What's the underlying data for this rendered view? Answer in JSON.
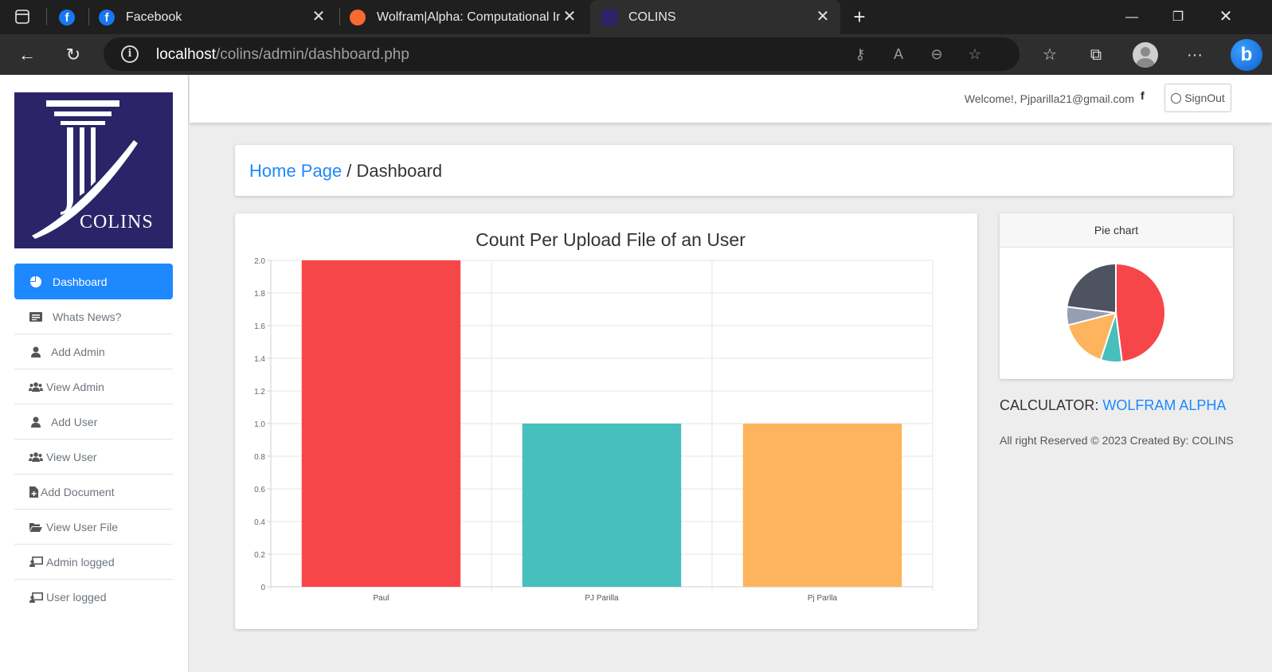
{
  "browser": {
    "tabs": [
      {
        "title": "Facebook",
        "icon": "facebook-icon"
      },
      {
        "title": "Wolfram|Alpha: Computational Intelligence",
        "icon": "wolfram-icon"
      },
      {
        "title": "COLINS",
        "icon": "colins-icon",
        "active": true
      }
    ],
    "url_host": "localhost",
    "url_path": "/colins/admin/dashboard.php"
  },
  "sidebar": {
    "logo_text": "COLINS",
    "items": [
      {
        "label": "Dashboard",
        "icon": "chart-pie-icon",
        "active": true
      },
      {
        "label": "Whats News?",
        "icon": "newspaper-icon"
      },
      {
        "label": "Add Admin",
        "icon": "user-icon"
      },
      {
        "label": "View Admin",
        "icon": "users-icon"
      },
      {
        "label": "Add User",
        "icon": "user-icon"
      },
      {
        "label": "View User",
        "icon": "users-icon"
      },
      {
        "label": "Add Document",
        "icon": "file-plus-icon"
      },
      {
        "label": "View User File",
        "icon": "folder-open-icon"
      },
      {
        "label": "Admin logged",
        "icon": "chalkboard-user-icon"
      },
      {
        "label": "User logged",
        "icon": "chalkboard-user-icon"
      }
    ]
  },
  "header": {
    "welcome": "Welcome!, Pjparilla21@gmail.com",
    "signout_label": "SignOut"
  },
  "breadcrumb": {
    "home": "Home Page",
    "separator": " / ",
    "current": "Dashboard"
  },
  "pie": {
    "title": "Pie chart"
  },
  "calculator": {
    "label": "CALCULATOR:",
    "link": "WOLFRAM ALPHA"
  },
  "footer": {
    "text": "All right Reserved © 2023 Created By: COLINS"
  },
  "colors": {
    "primary": "#1e88ff",
    "red": "#f7464a",
    "teal": "#46bfbd",
    "orange": "#fdb45c",
    "gray": "#949fb1",
    "dark": "#4d5360",
    "logo_bg": "#2b2468"
  },
  "chart_data": [
    {
      "type": "bar",
      "title": "Count Per Upload File of an User",
      "categories": [
        "Paul",
        "PJ Parilla",
        "Pj Parlla"
      ],
      "values": [
        2,
        1,
        1
      ],
      "colors": [
        "#f7464a",
        "#46bfbd",
        "#fdb45c"
      ],
      "ylim": [
        0,
        2
      ],
      "yticks": [
        "0",
        "0.2",
        "0.4",
        "0.6",
        "0.8",
        "1.0",
        "1.2",
        "1.4",
        "1.6",
        "1.8",
        "2.0"
      ],
      "grid": true
    },
    {
      "type": "pie",
      "title": "Pie chart",
      "values": [
        48,
        7,
        16,
        6,
        23
      ],
      "colors": [
        "#f7464a",
        "#46bfbd",
        "#fdb45c",
        "#949fb1",
        "#4d5360"
      ]
    }
  ]
}
